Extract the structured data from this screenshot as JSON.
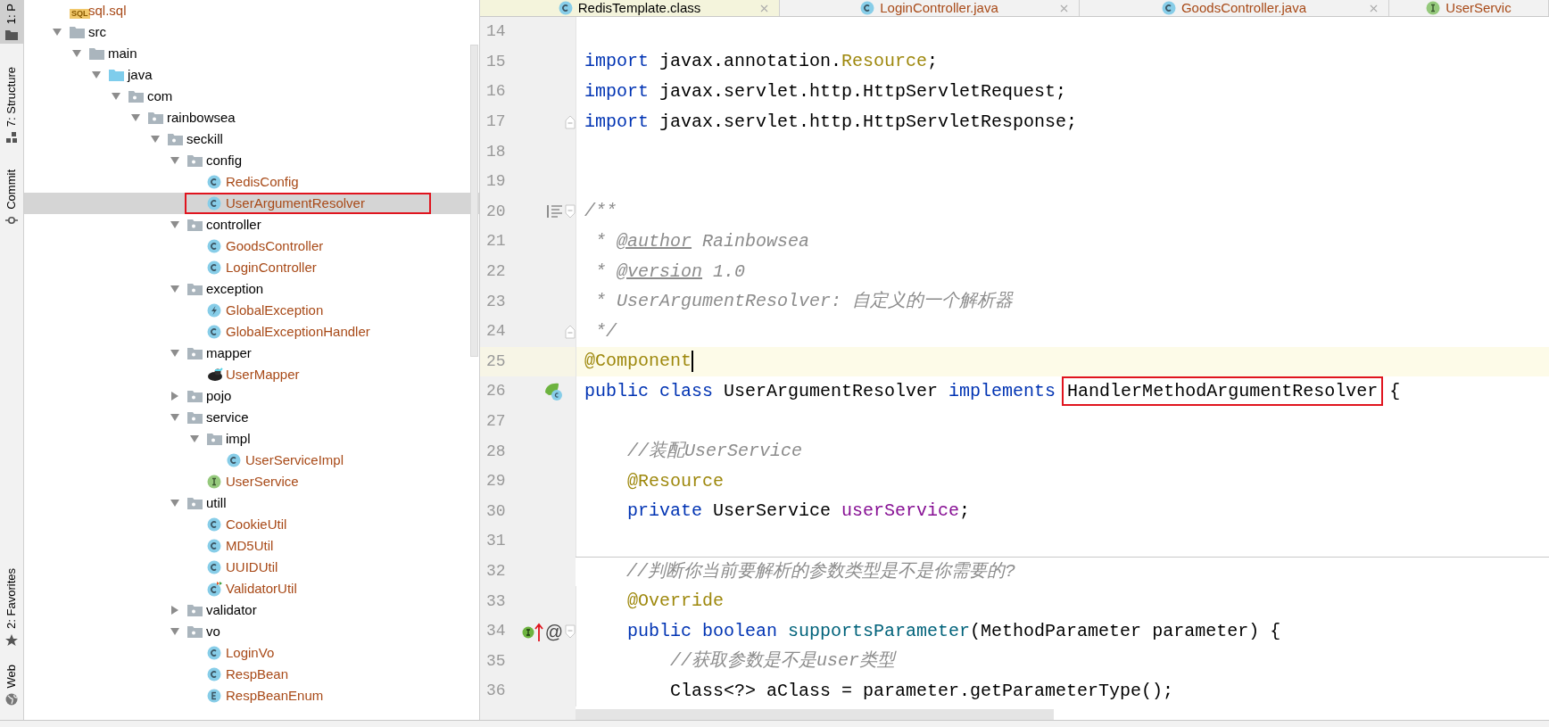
{
  "tool_strip": [
    {
      "label": "1: P",
      "kind": "project",
      "selected": true
    },
    {
      "label": "7: Structure",
      "kind": "structure",
      "selected": false
    },
    {
      "label": "Commit",
      "kind": "commit",
      "selected": false
    },
    {
      "label": "2: Favorites",
      "kind": "favorites",
      "selected": false
    },
    {
      "label": "Web",
      "kind": "web",
      "selected": false
    }
  ],
  "project_tree": [
    {
      "label": "sql.sql",
      "kind": "sql",
      "badge": "SQL",
      "selected": false,
      "highlighted": false
    },
    {
      "label": "src",
      "kind": "folder",
      "expanded": true,
      "selected": false,
      "highlighted": false,
      "children": [
        {
          "label": "main",
          "kind": "folder",
          "expanded": true,
          "selected": false,
          "highlighted": false,
          "children": [
            {
              "label": "java",
              "kind": "source_folder",
              "expanded": true,
              "selected": false,
              "highlighted": false,
              "children": [
                {
                  "label": "com",
                  "kind": "package",
                  "expanded": true,
                  "selected": false,
                  "highlighted": false,
                  "children": [
                    {
                      "label": "rainbowsea",
                      "kind": "package",
                      "expanded": true,
                      "selected": false,
                      "highlighted": false,
                      "children": [
                        {
                          "label": "seckill",
                          "kind": "package",
                          "expanded": true,
                          "selected": false,
                          "highlighted": false,
                          "children": [
                            {
                              "label": "config",
                              "kind": "package",
                              "expanded": true,
                              "selected": false,
                              "highlighted": false,
                              "children": [
                                {
                                  "label": "RedisConfig",
                                  "kind": "class",
                                  "selected": false,
                                  "highlighted": false
                                },
                                {
                                  "label": "UserArgumentResolver",
                                  "kind": "class",
                                  "selected": true,
                                  "highlighted": true
                                }
                              ]
                            },
                            {
                              "label": "controller",
                              "kind": "package",
                              "expanded": true,
                              "selected": false,
                              "highlighted": false,
                              "children": [
                                {
                                  "label": "GoodsController",
                                  "kind": "class",
                                  "selected": false,
                                  "highlighted": false
                                },
                                {
                                  "label": "LoginController",
                                  "kind": "class",
                                  "selected": false,
                                  "highlighted": false
                                }
                              ]
                            },
                            {
                              "label": "exception",
                              "kind": "package",
                              "expanded": true,
                              "selected": false,
                              "highlighted": false,
                              "children": [
                                {
                                  "label": "GlobalException",
                                  "kind": "exception",
                                  "selected": false,
                                  "highlighted": false
                                },
                                {
                                  "label": "GlobalExceptionHandler",
                                  "kind": "class",
                                  "selected": false,
                                  "highlighted": false
                                }
                              ]
                            },
                            {
                              "label": "mapper",
                              "kind": "package",
                              "expanded": true,
                              "selected": false,
                              "highlighted": false,
                              "children": [
                                {
                                  "label": "UserMapper",
                                  "kind": "mapper",
                                  "selected": false,
                                  "highlighted": false
                                }
                              ]
                            },
                            {
                              "label": "pojo",
                              "kind": "package",
                              "expanded": false,
                              "selected": false,
                              "highlighted": false
                            },
                            {
                              "label": "service",
                              "kind": "package",
                              "expanded": true,
                              "selected": false,
                              "highlighted": false,
                              "children": [
                                {
                                  "label": "impl",
                                  "kind": "package",
                                  "expanded": true,
                                  "selected": false,
                                  "highlighted": false,
                                  "children": [
                                    {
                                      "label": "UserServiceImpl",
                                      "kind": "class",
                                      "selected": false,
                                      "highlighted": false
                                    }
                                  ]
                                },
                                {
                                  "label": "UserService",
                                  "kind": "interface",
                                  "selected": false,
                                  "highlighted": false
                                }
                              ]
                            },
                            {
                              "label": "utill",
                              "kind": "package",
                              "expanded": true,
                              "selected": false,
                              "highlighted": false,
                              "children": [
                                {
                                  "label": "CookieUtil",
                                  "kind": "class",
                                  "selected": false,
                                  "highlighted": false
                                },
                                {
                                  "label": "MD5Util",
                                  "kind": "class",
                                  "selected": false,
                                  "highlighted": false
                                },
                                {
                                  "label": "UUIDUtil",
                                  "kind": "class",
                                  "selected": false,
                                  "highlighted": false
                                },
                                {
                                  "label": "ValidatorUtil",
                                  "kind": "class_changed",
                                  "selected": false,
                                  "highlighted": false
                                }
                              ]
                            },
                            {
                              "label": "validator",
                              "kind": "package",
                              "expanded": false,
                              "selected": false,
                              "highlighted": false
                            },
                            {
                              "label": "vo",
                              "kind": "package",
                              "expanded": true,
                              "selected": false,
                              "highlighted": false,
                              "children": [
                                {
                                  "label": "LoginVo",
                                  "kind": "class",
                                  "selected": false,
                                  "highlighted": false
                                },
                                {
                                  "label": "RespBean",
                                  "kind": "class",
                                  "selected": false,
                                  "highlighted": false
                                },
                                {
                                  "label": "RespBeanEnum",
                                  "kind": "enum",
                                  "selected": false,
                                  "highlighted": false
                                }
                              ]
                            }
                          ]
                        }
                      ]
                    }
                  ]
                }
              ]
            }
          ]
        }
      ]
    }
  ],
  "editor_tabs": [
    {
      "label": "RedisTemplate.class",
      "kind": "library",
      "closable": true
    },
    {
      "label": "LoginController.java",
      "kind": "class",
      "closable": true
    },
    {
      "label": "GoodsController.java",
      "kind": "class",
      "closable": true
    },
    {
      "label": "UserServic",
      "kind": "interface",
      "closable": false
    }
  ],
  "code_lines": [
    {
      "number": "14",
      "current": false,
      "separator": false
    },
    {
      "number": "15",
      "current": false,
      "separator": false,
      "tokens": [
        {
          "kind": "kw",
          "text": "import "
        },
        {
          "kind": "plain",
          "text": "javax.annotation."
        },
        {
          "kind": "ann",
          "text": "Resource"
        },
        {
          "kind": "plain",
          "text": ";"
        }
      ]
    },
    {
      "number": "16",
      "current": false,
      "separator": false,
      "tokens": [
        {
          "kind": "kw",
          "text": "import "
        },
        {
          "kind": "plain",
          "text": "javax.servlet.http.HttpServletRequest;"
        }
      ]
    },
    {
      "number": "17",
      "current": false,
      "separator": false,
      "gutter": [
        {
          "kind": "fold_end"
        }
      ],
      "tokens": [
        {
          "kind": "kw",
          "text": "import "
        },
        {
          "kind": "plain",
          "text": "javax.servlet.http.HttpServletResponse;"
        }
      ]
    },
    {
      "number": "18",
      "current": false,
      "separator": false
    },
    {
      "number": "19",
      "current": false,
      "separator": false
    },
    {
      "number": "20",
      "current": false,
      "separator": false,
      "gutter": [
        {
          "kind": "doc"
        },
        {
          "kind": "fold_start"
        }
      ],
      "tokens": [
        {
          "kind": "comment",
          "text": "/**"
        }
      ]
    },
    {
      "number": "21",
      "current": false,
      "separator": false,
      "tokens": [
        {
          "kind": "comment",
          "text": " * "
        },
        {
          "kind": "doc_tag",
          "text": "@author"
        },
        {
          "kind": "comment",
          "text": " Rainbowsea"
        }
      ]
    },
    {
      "number": "22",
      "current": false,
      "separator": false,
      "tokens": [
        {
          "kind": "comment",
          "text": " * "
        },
        {
          "kind": "doc_tag",
          "text": "@version"
        },
        {
          "kind": "comment",
          "text": " 1.0"
        }
      ]
    },
    {
      "number": "23",
      "current": false,
      "separator": false,
      "tokens": [
        {
          "kind": "comment",
          "text": " * UserArgumentResolver: 自定义的一个解析器"
        }
      ]
    },
    {
      "number": "24",
      "current": false,
      "separator": false,
      "gutter": [
        {
          "kind": "fold_end"
        }
      ],
      "tokens": [
        {
          "kind": "comment",
          "text": " */"
        }
      ]
    },
    {
      "number": "25",
      "current": true,
      "separator": false,
      "tokens": [
        {
          "kind": "ann",
          "text": "@Component"
        }
      ]
    },
    {
      "number": "26",
      "current": false,
      "separator": false,
      "gutter": [
        {
          "kind": "bean"
        }
      ],
      "tokens": [
        {
          "kind": "kw",
          "text": "public "
        },
        {
          "kind": "kw",
          "text": "class "
        },
        {
          "kind": "plain",
          "text": "UserArgumentResolver "
        },
        {
          "kind": "kw",
          "text": "implements "
        },
        {
          "kind": "plain",
          "text": "HandlerMethodArgumentResolver",
          "boxed": true
        },
        {
          "kind": "plain",
          "text": " {"
        }
      ]
    },
    {
      "number": "27",
      "current": false,
      "separator": false
    },
    {
      "number": "28",
      "current": false,
      "separator": false,
      "tokens": [
        {
          "kind": "comment",
          "text": "    //装配UserService"
        }
      ]
    },
    {
      "number": "29",
      "current": false,
      "separator": false,
      "tokens": [
        {
          "kind": "ann",
          "text": "    @Resource"
        }
      ]
    },
    {
      "number": "30",
      "current": false,
      "separator": false,
      "tokens": [
        {
          "kind": "kw",
          "text": "    private "
        },
        {
          "kind": "plain",
          "text": "UserService "
        },
        {
          "kind": "field",
          "text": "userService"
        },
        {
          "kind": "plain",
          "text": ";"
        }
      ]
    },
    {
      "number": "31",
      "current": false,
      "separator": false
    },
    {
      "number": "32",
      "current": false,
      "separator": true,
      "tokens": [
        {
          "kind": "comment",
          "text": "    //判断你当前要解析的参数类型是不是你需要的?"
        }
      ]
    },
    {
      "number": "33",
      "current": false,
      "separator": false,
      "tokens": [
        {
          "kind": "ann",
          "text": "    @Override"
        }
      ]
    },
    {
      "number": "34",
      "current": false,
      "separator": false,
      "gutter": [
        {
          "kind": "implements"
        },
        {
          "kind": "text",
          "text": "@"
        },
        {
          "kind": "fold_start"
        }
      ],
      "tokens": [
        {
          "kind": "kw",
          "text": "    public "
        },
        {
          "kind": "kw",
          "text": "boolean "
        },
        {
          "kind": "method",
          "text": "supportsParameter"
        },
        {
          "kind": "plain",
          "text": "(MethodParameter parameter) {"
        }
      ]
    },
    {
      "number": "35",
      "current": false,
      "separator": false,
      "tokens": [
        {
          "kind": "comment",
          "text": "        //获取参数是不是user类型"
        }
      ]
    },
    {
      "number": "36",
      "current": false,
      "separator": false,
      "tokens": [
        {
          "kind": "plain",
          "text": "        Class<?> aClass = parameter.getParameterType();"
        }
      ]
    }
  ]
}
